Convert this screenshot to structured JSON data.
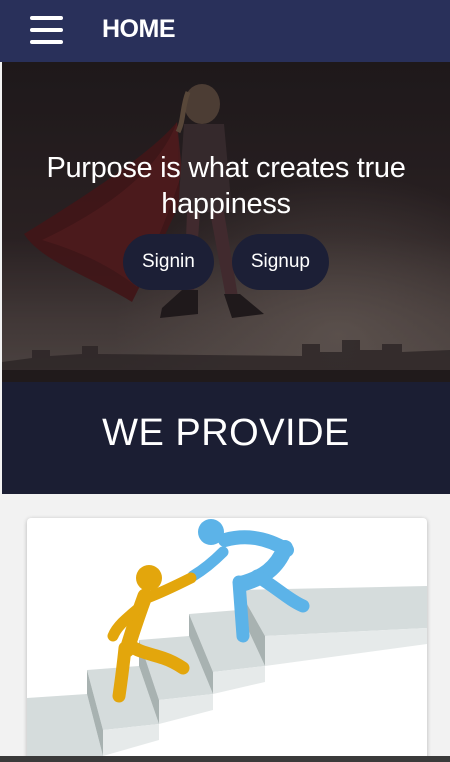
{
  "header": {
    "title": "HOME",
    "menu_icon": "hamburger-menu-icon"
  },
  "hero": {
    "headline": "Purpose is what creates true happiness",
    "signin_label": "Signin",
    "signup_label": "Signup"
  },
  "provide": {
    "title": "WE PROVIDE"
  },
  "card": {
    "illustration": "helping-hand-stairs-illustration"
  },
  "colors": {
    "header_bg": "#29305a",
    "band_bg": "#1b1e33",
    "button_bg": "#1c1f36",
    "figure_yellow": "#e3a60c",
    "figure_blue": "#5cb3e8",
    "stair_gray": "#c9d0d0"
  }
}
